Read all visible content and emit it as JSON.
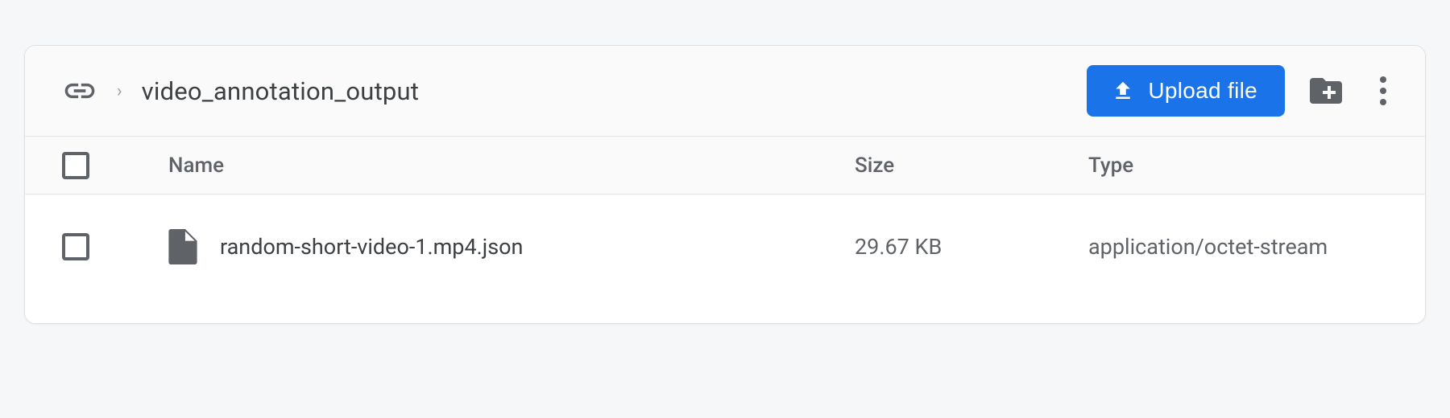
{
  "toolbar": {
    "folder_name": "video_annotation_output",
    "upload_label": "Upload file"
  },
  "columns": {
    "name": "Name",
    "size": "Size",
    "type": "Type"
  },
  "files": [
    {
      "name": "random-short-video-1.mp4.json",
      "size": "29.67 KB",
      "type": "application/octet-stream"
    }
  ]
}
